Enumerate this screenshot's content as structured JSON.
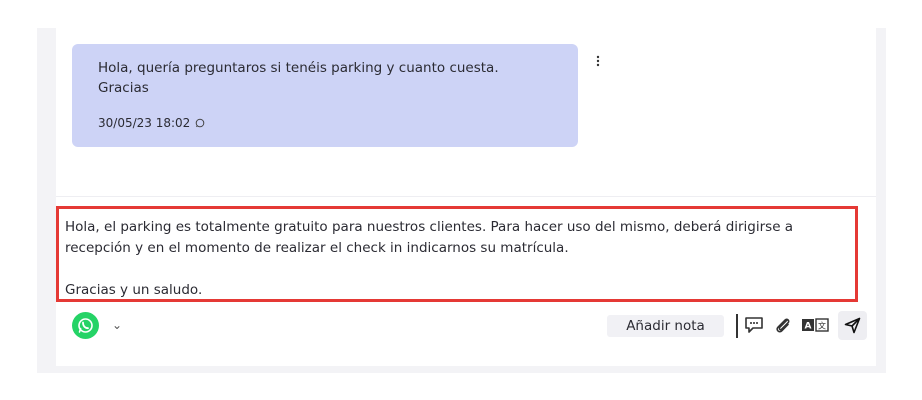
{
  "conversation": {
    "incoming_message": {
      "text": "Hola, quería preguntaros si tenéis parking y cuanto cuesta.\nGracias",
      "timestamp": "30/05/23 18:02",
      "channel_icon": "whatsapp-icon"
    },
    "options_icon": "kebab-menu-icon"
  },
  "composer": {
    "reply_text": "Hola, el parking es totalmente gratuito para nuestros clientes. Para hacer uso del mismo, deberá dirigirse a\nrecepción y en el momento de realizar el check in indicarnos su matrícula.\n\nGracias y un saludo.",
    "channel_icon": "whatsapp-icon",
    "channel_dropdown_icon": "chevron-down-icon",
    "add_note_label": "Añadir nota",
    "tools": [
      "quick-reply-icon",
      "attachment-icon",
      "translate-icon",
      "send-icon"
    ],
    "accent_color": "#25d366",
    "highlight_color": "#e53935"
  }
}
